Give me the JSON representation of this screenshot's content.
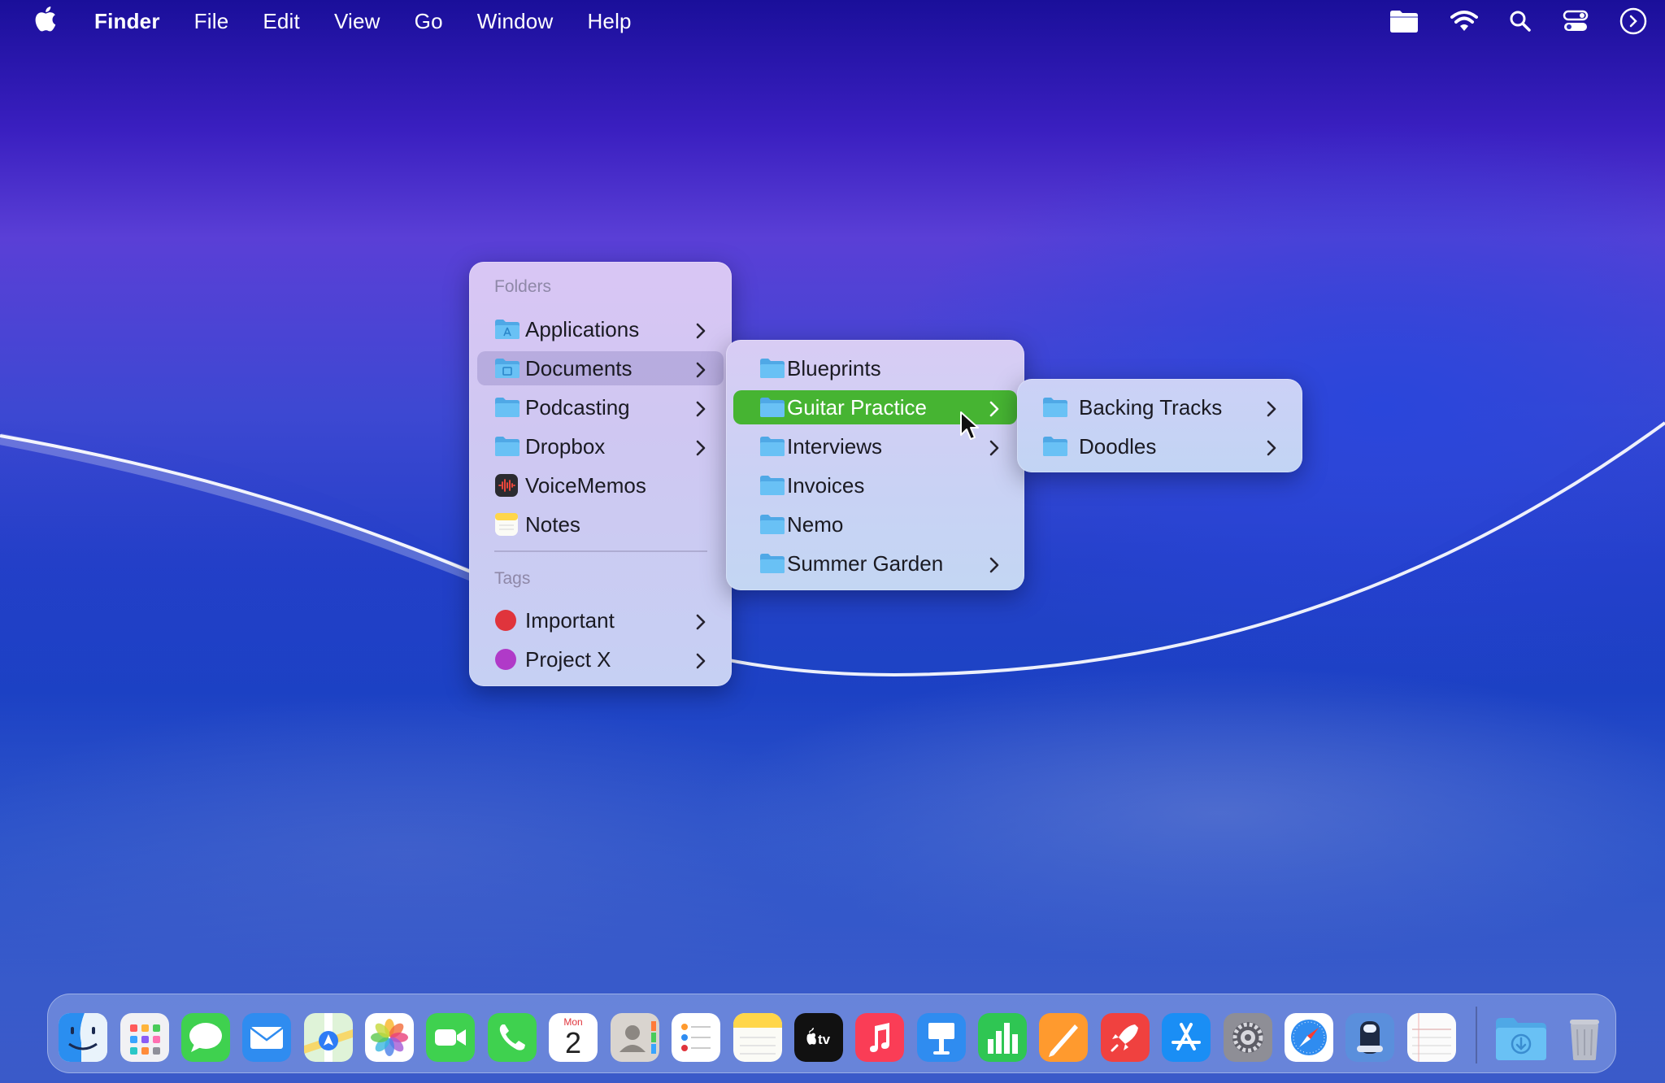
{
  "menubar": {
    "app_name": "Finder",
    "menus": [
      "File",
      "Edit",
      "View",
      "Go",
      "Window",
      "Help"
    ],
    "status_icons": [
      "folder-icon",
      "wifi-icon",
      "search-icon",
      "control-center-icon",
      "siri-icon"
    ]
  },
  "folders_menu": {
    "folders_header": "Folders",
    "items": [
      {
        "label": "Applications",
        "icon": "folder-icon",
        "submenu": true
      },
      {
        "label": "Documents",
        "icon": "folder-icon",
        "submenu": true,
        "highlighted": true
      },
      {
        "label": "Podcasting",
        "icon": "folder-icon",
        "submenu": true
      },
      {
        "label": "Dropbox",
        "icon": "folder-icon",
        "submenu": true
      },
      {
        "label": "VoiceMemos",
        "icon": "voice-memos-icon",
        "submenu": false
      },
      {
        "label": "Notes",
        "icon": "notes-icon",
        "submenu": false
      }
    ],
    "tags_header": "Tags",
    "tags": [
      {
        "label": "Important",
        "color": "#e0343c",
        "submenu": true
      },
      {
        "label": "Project X",
        "color": "#b03ac8",
        "submenu": true
      }
    ]
  },
  "documents_menu": {
    "items": [
      {
        "label": "Blueprints",
        "submenu": false
      },
      {
        "label": "Guitar Practice",
        "submenu": true,
        "selected": true
      },
      {
        "label": "Interviews",
        "submenu": true
      },
      {
        "label": "Invoices",
        "submenu": false
      },
      {
        "label": "Nemo",
        "submenu": false
      },
      {
        "label": "Summer Garden",
        "submenu": true
      }
    ]
  },
  "guitar_menu": {
    "items": [
      {
        "label": "Backing Tracks",
        "submenu": true
      },
      {
        "label": "Doodles",
        "submenu": true
      }
    ]
  },
  "dock": {
    "calendar_month": "Mon",
    "calendar_day": "2",
    "apps": [
      "finder-icon",
      "launchpad-icon",
      "messages-icon",
      "mail-icon",
      "maps-icon",
      "photos-icon",
      "facetime-icon",
      "phone-icon",
      "calendar-icon",
      "contacts-icon",
      "reminders-icon",
      "notes-icon",
      "apple-tv-icon",
      "music-icon",
      "keynote-icon",
      "numbers-icon",
      "pages-icon",
      "rocket-typist-icon",
      "app-store-icon",
      "system-settings-icon",
      "safari-icon",
      "script-editor-icon",
      "textedit-icon",
      "downloads-folder-icon",
      "trash-icon"
    ]
  },
  "colors": {
    "selection_green": "#46b432",
    "folder_blue": "#5bb4ee"
  }
}
